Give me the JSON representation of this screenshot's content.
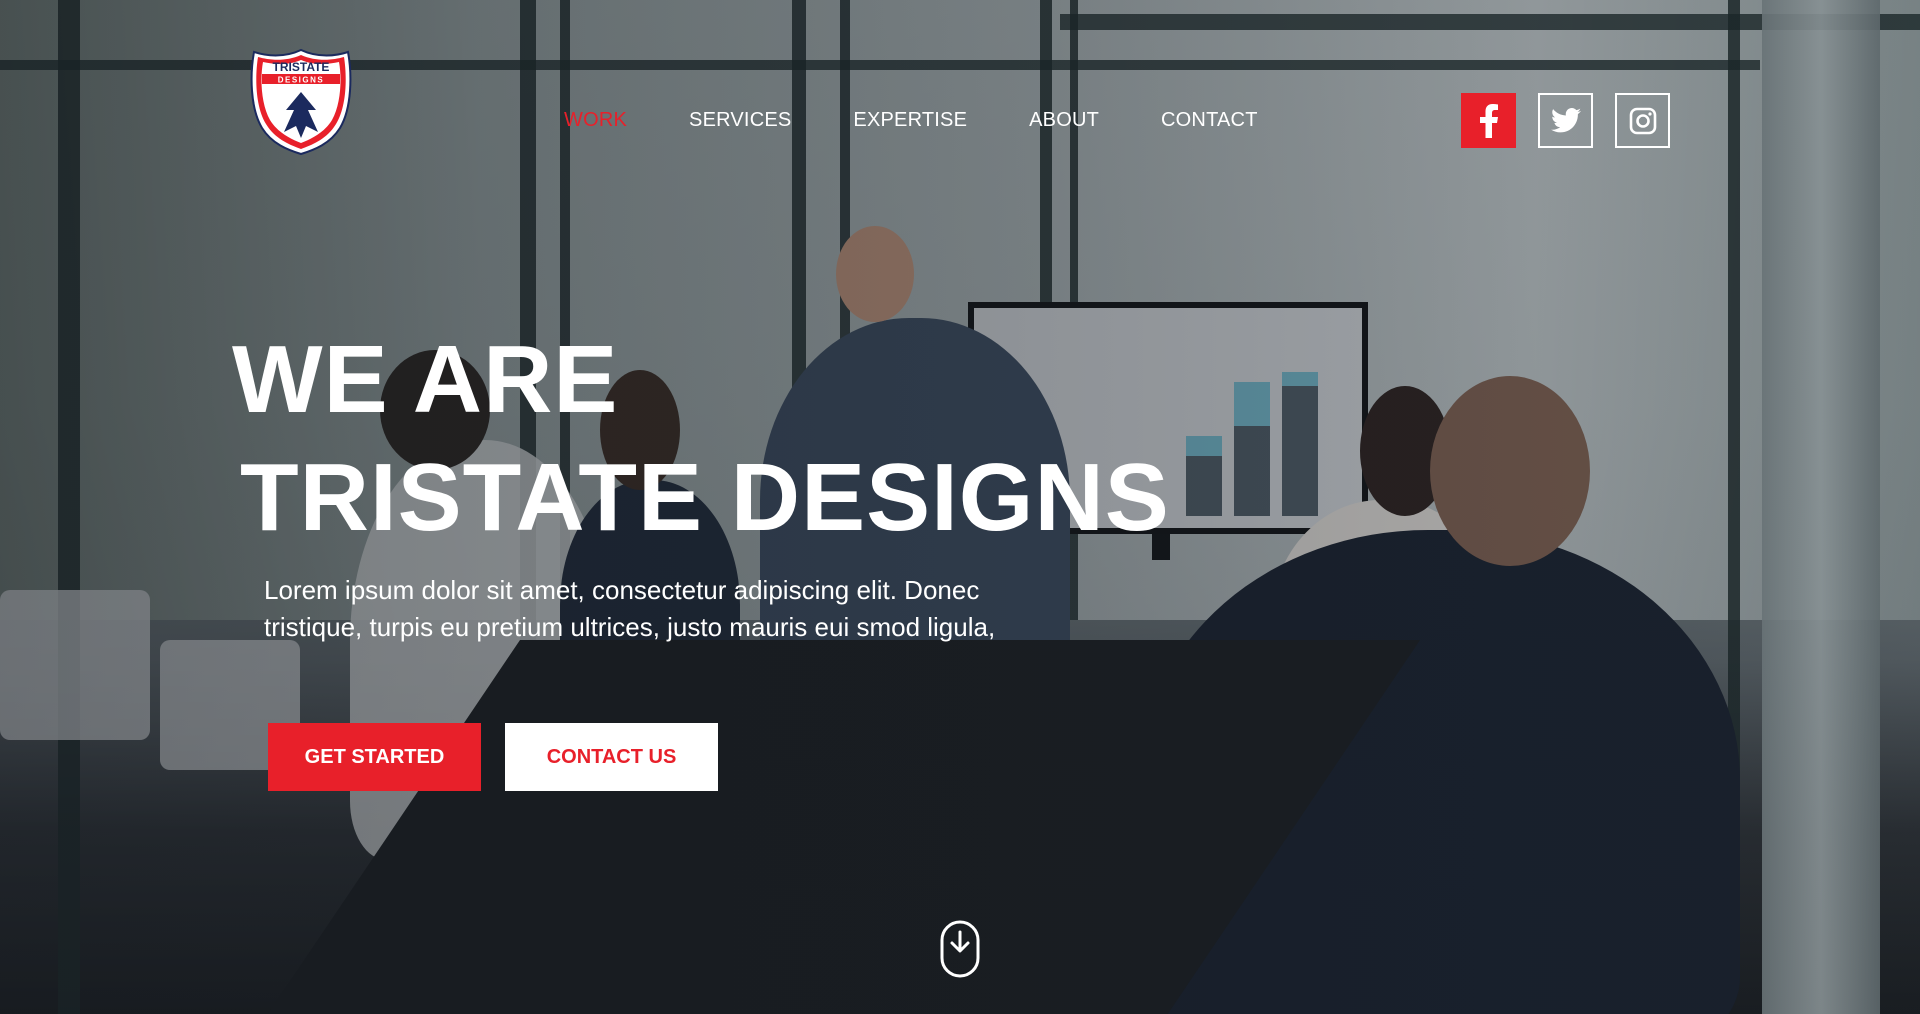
{
  "brand": {
    "logo_top": "TRISTATE",
    "logo_bottom": "DESIGNS",
    "colors": {
      "accent": "#e8202a",
      "navy": "#1b2a5e",
      "white": "#ffffff"
    }
  },
  "nav": {
    "items": [
      {
        "label": "WORK",
        "active": true
      },
      {
        "label": "SERVICES",
        "active": false
      },
      {
        "label": "EXPERTISE",
        "active": false
      },
      {
        "label": "ABOUT",
        "active": false
      },
      {
        "label": "CONTACT",
        "active": false
      }
    ]
  },
  "social": [
    {
      "icon": "facebook-icon"
    },
    {
      "icon": "twitter-icon"
    },
    {
      "icon": "instagram-icon"
    }
  ],
  "hero": {
    "line1": "WE ARE",
    "line2": "TRISTATE DESIGNS",
    "lead": "Lorem ipsum dolor sit amet, consectetur adipiscing elit. Donec tristique, turpis eu pretium ultrices, justo mauris eui smod ligula,",
    "primary_button": "GET STARTED",
    "secondary_button": "CONTACT US",
    "scroll_icon": "scroll-down-icon"
  }
}
